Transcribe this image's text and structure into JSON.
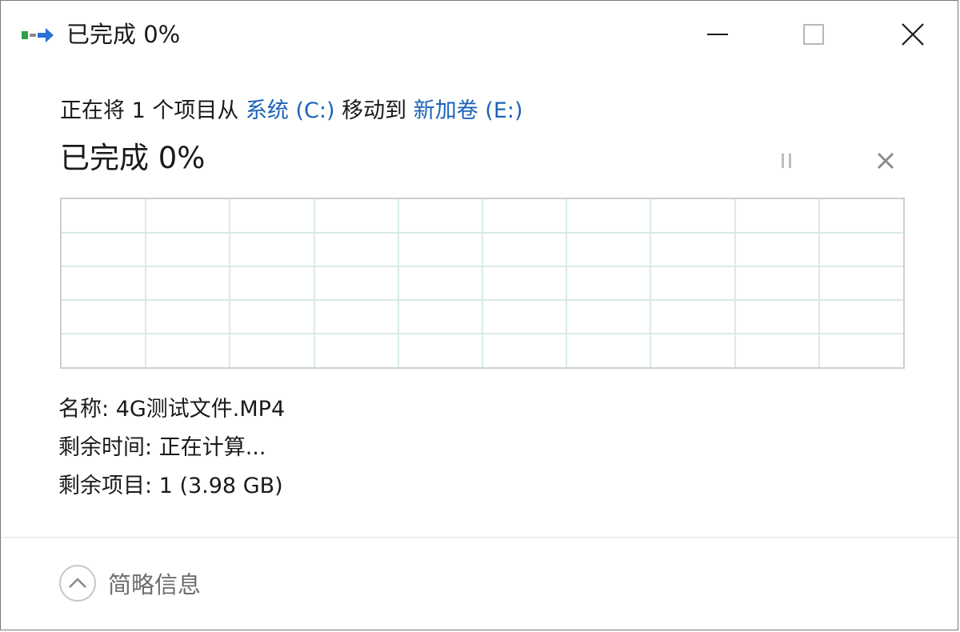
{
  "window": {
    "title": "已完成 0%"
  },
  "operation": {
    "prefix": "正在将 1 个项目从 ",
    "source": "系统 (C:)",
    "middle": " 移动到 ",
    "destination": "新加卷 (E:)",
    "progress_text": "已完成 0%",
    "progress_percent": 0
  },
  "details": {
    "name_label": "名称:",
    "name_value": "4G测试文件.MP4",
    "time_label": "剩余时间:",
    "time_value": "正在计算...",
    "items_label": "剩余项目:",
    "items_value": "1 (3.98 GB)"
  },
  "footer": {
    "toggle_label": "简略信息"
  },
  "icons": {
    "app": "file-move-icon",
    "minimize": "minimize-icon",
    "maximize": "maximize-icon",
    "close": "close-icon",
    "pause": "pause-icon",
    "cancel": "cancel-icon",
    "collapse": "chevron-up-icon"
  },
  "colors": {
    "link": "#1c63b8",
    "grid": "#d7ecdf",
    "graph_border": "#cfcfcf"
  }
}
